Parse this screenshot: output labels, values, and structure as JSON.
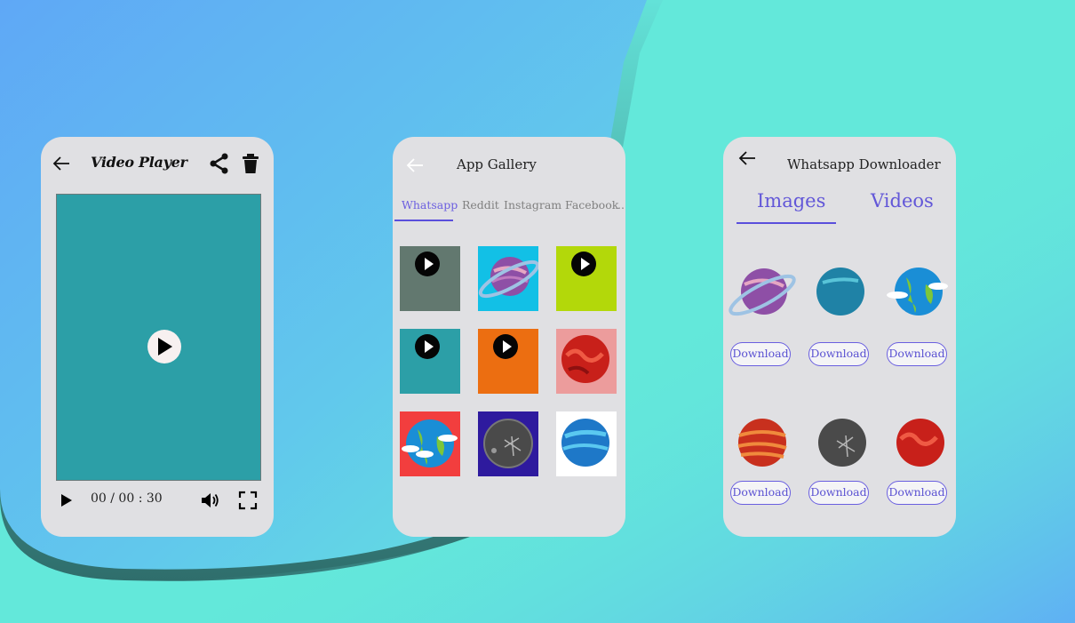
{
  "colors": {
    "accent": "#5a4fdc",
    "card_bg": "#e0e0e3",
    "video_screen": "#2c9fa7"
  },
  "video_player": {
    "title": "Video Player",
    "back_icon": "arrow-left-icon",
    "share_icon": "share-icon",
    "delete_icon": "trash-icon",
    "time": "00 / 00 : 30",
    "progress": 0,
    "controls": [
      "play-icon",
      "volume-icon",
      "fullscreen-icon"
    ]
  },
  "app_gallery": {
    "title": "App Gallery",
    "back_icon": "arrow-left-icon",
    "tabs": [
      {
        "label": "Whatsapp",
        "active": true
      },
      {
        "label": "Reddit",
        "active": false
      },
      {
        "label": "Instagram",
        "active": false
      },
      {
        "label": "Facebook",
        "active": false
      },
      {
        "label": "..",
        "active": false
      }
    ],
    "items": [
      {
        "type": "video",
        "bg": "#62786f"
      },
      {
        "type": "image",
        "bg": "#12c0e6",
        "subject": "ringed-planet"
      },
      {
        "type": "video",
        "bg": "#b3d80a"
      },
      {
        "type": "video",
        "bg": "#2c9fa7"
      },
      {
        "type": "video",
        "bg": "#ec6e11"
      },
      {
        "type": "image",
        "bg": "#ec9c9c",
        "subject": "red-planet"
      },
      {
        "type": "image",
        "bg": "#f23e3e",
        "subject": "earth"
      },
      {
        "type": "image",
        "bg": "#2e1a9e",
        "subject": "moon"
      },
      {
        "type": "image",
        "bg": "#ffffff",
        "subject": "blue-planet"
      }
    ]
  },
  "whatsapp_downloader": {
    "title": "Whatsapp Downloader",
    "back_icon": "arrow-left-icon",
    "tabs": [
      {
        "label": "Images",
        "active": true
      },
      {
        "label": "Videos",
        "active": false
      }
    ],
    "items": [
      {
        "subject": "ringed-planet",
        "button": "Download"
      },
      {
        "subject": "teal-planet",
        "button": "Download"
      },
      {
        "subject": "earth",
        "button": "Download"
      },
      {
        "subject": "jupiter",
        "button": "Download"
      },
      {
        "subject": "moon",
        "button": "Download"
      },
      {
        "subject": "red-planet",
        "button": "Download"
      }
    ]
  }
}
